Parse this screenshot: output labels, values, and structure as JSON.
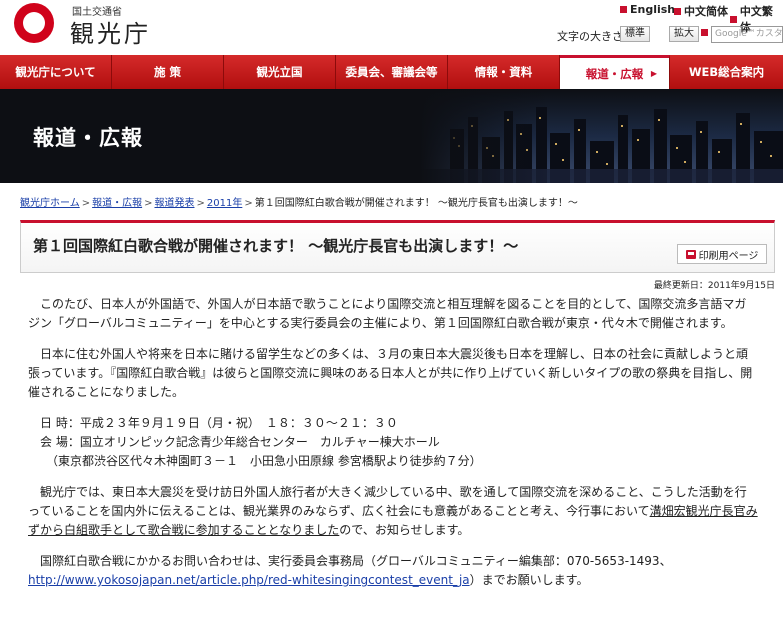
{
  "header": {
    "logo_sub": "国土交通省",
    "logo_main": "観光庁",
    "lang_links": [
      "English",
      "中文简体",
      "中文繁体"
    ],
    "font_size_label": "文字の大きさ",
    "font_std": "標準",
    "font_large": "拡大",
    "search_placeholder": "Google™カスタム"
  },
  "nav": {
    "items": [
      "観光庁について",
      "施 策",
      "観光立国",
      "委員会、審議会等",
      "情報・資料",
      "報道・広報",
      "WEB総合案内"
    ],
    "active_index": 5
  },
  "hero": {
    "title": "報道・広報"
  },
  "breadcrumb": {
    "items": [
      "観光庁ホーム",
      "報道・広報",
      "報道発表",
      "2011年"
    ],
    "current": "第１回国際紅白歌合戦が開催されます！ ～観光庁長官も出演します！～",
    "separator": ">"
  },
  "article": {
    "title": "第１回国際紅白歌合戦が開催されます！ ～観光庁長官も出演します！～",
    "print_label": "印刷用ページ",
    "updated": "最終更新日：2011年9月15日",
    "para1": "　このたび、日本人が外国語で、外国人が日本語で歌うことにより国際交流と相互理解を図ることを目的として、国際交流多言語マガジン「グローバルコミュニティー」を中心とする実行委員会の主催により、第１回国際紅白歌合戦が東京・代々木で開催されます。",
    "para2": "　日本に住む外国人や将来を日本に賭ける留学生などの多くは、３月の東日本大震災後も日本を理解し、日本の社会に貢献しようと頑張っています。『国際紅白歌合戦』は彼らと国際交流に興味のある日本人とが共に作り上げていく新しいタイプの歌の祭典を目指し、開催されることになりました。",
    "date_line": "　日 時：平成２３年９月１９日（月・祝）　１８：３０～２１：３０",
    "venue_line": "　会 場：国立オリンピック記念青少年総合センター　カルチャー棟大ホール",
    "address_line": "　　（東京都渋谷区代々木神園町３－１　小田急小田原線 参宮橋駅より徒歩約７分）",
    "para3_pre": "　観光庁では、東日本大震災を受け訪日外国人旅行者が大きく減少している中、歌を通して国際交流を深めること、こうした活動を行っていることを国内外に伝えることは、観光業界のみならず、広く社会にも意義があることと考え、今行事において",
    "para3_hl": "溝畑宏観光庁長官みずから白組歌手として歌合戦に参加することとなりました",
    "para3_post": "ので、お知らせします。",
    "contact_pre": "　国際紅白歌合戦にかかるお問い合わせは、実行委員会事務局（グローバルコミュニティー編集部：070-5653-1493、 ",
    "contact_url": "http://www.yokosojapan.net/article.php/red-whitesingingcontest_event_ja",
    "contact_post": "）までお願いします。"
  },
  "colors": {
    "brand_red": "#c8102e",
    "link_blue": "#1a3fa8"
  }
}
